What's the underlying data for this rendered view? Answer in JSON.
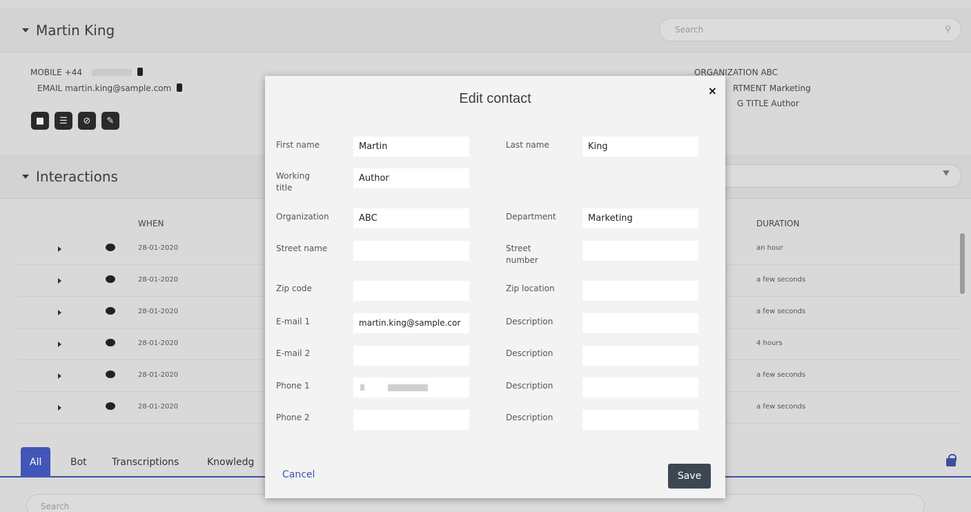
{
  "contact": {
    "name": "Martin King",
    "search_placeholder": "Search",
    "mobile_label": "MOBILE",
    "mobile_value": "+44",
    "email_label": "EMAIL",
    "email_value": "martin.king@sample.com",
    "org_label": "ORGANIZATION",
    "org_value": "ABC",
    "dept_label": "RTMENT",
    "dept_value": "Marketing",
    "title_label": "G TITLE",
    "title_value": "Author"
  },
  "interactions": {
    "title": "Interactions",
    "col_when": "WHEN",
    "col_duration": "DURATION",
    "rows": [
      {
        "when": "28-01-2020",
        "duration": "an hour"
      },
      {
        "when": "28-01-2020",
        "duration": "a few seconds"
      },
      {
        "when": "28-01-2020",
        "duration": "a few seconds"
      },
      {
        "when": "28-01-2020",
        "duration": "4 hours"
      },
      {
        "when": "28-01-2020",
        "duration": "a few seconds"
      },
      {
        "when": "28-01-2020",
        "duration": "a few seconds"
      }
    ]
  },
  "tabs": [
    "All",
    "Bot",
    "Transcriptions",
    "Knowledg"
  ],
  "bottom_search_placeholder": "Search",
  "modal": {
    "title": "Edit contact",
    "close": "×",
    "labels": {
      "first_name": "First name",
      "last_name": "Last name",
      "working_title": "Working title",
      "organization": "Organization",
      "department": "Department",
      "street_name": "Street name",
      "street_number": "Street number",
      "zip_code": "Zip code",
      "zip_location": "Zip location",
      "email1": "E-mail 1",
      "email2": "E-mail 2",
      "phone1": "Phone 1",
      "phone2": "Phone 2",
      "description": "Description"
    },
    "values": {
      "first_name": "Martin",
      "last_name": "King",
      "working_title": "Author",
      "organization": "ABC",
      "department": "Marketing",
      "street_name": "",
      "street_number": "",
      "zip_code": "",
      "zip_location": "",
      "email1": "martin.king@sample.cor",
      "email1_desc": "",
      "email2": "",
      "email2_desc": "",
      "phone1": "",
      "phone1_desc": "",
      "phone2": "",
      "phone2_desc": ""
    },
    "cancel": "Cancel",
    "save": "Save"
  },
  "colors": {
    "accent": "#4156b8",
    "save_bg": "#3c4752",
    "link": "#3a55b6"
  }
}
